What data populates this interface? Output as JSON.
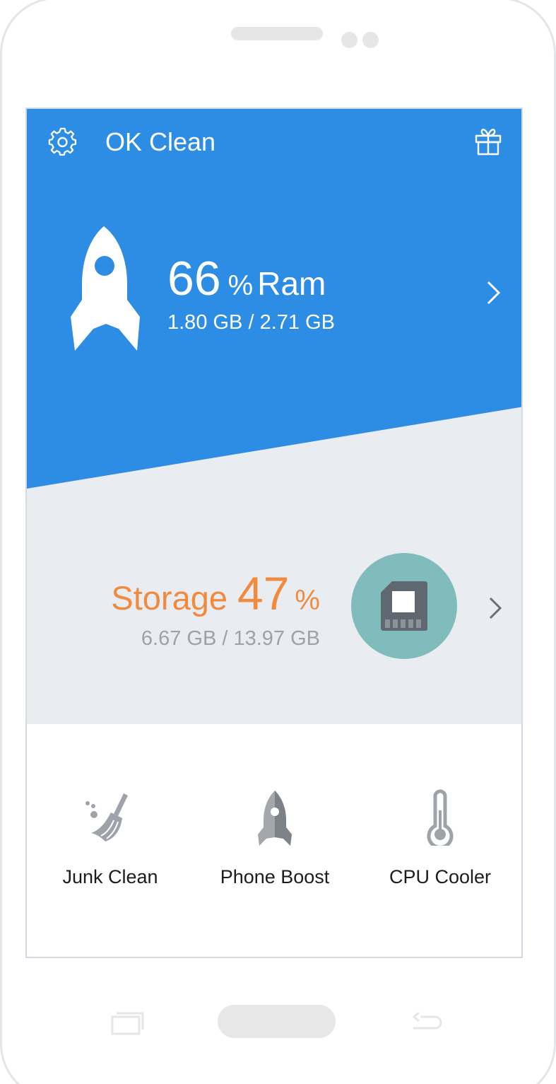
{
  "app": {
    "title": "OK Clean",
    "settings_icon": "gear-icon",
    "gift_icon": "gift-icon",
    "accent_color": "#2d8de5",
    "storage_color": "#f08a3e"
  },
  "ram": {
    "icon": "rocket-icon",
    "value": "66",
    "unit": "%",
    "label": "Ram",
    "detail": "1.80 GB / 2.71 GB"
  },
  "storage": {
    "label": "Storage",
    "value": "47",
    "unit": "%",
    "detail": "6.67 GB / 13.97 GB",
    "icon": "sd-card-icon",
    "icon_circle_color": "#7fbcbb"
  },
  "tools": [
    {
      "label": "Junk Clean",
      "icon": "broom-icon"
    },
    {
      "label": "Phone Boost",
      "icon": "rocket-icon"
    },
    {
      "label": "CPU Cooler",
      "icon": "thermometer-icon"
    }
  ],
  "navbar": {
    "recent_icon": "recent-apps-icon",
    "home_icon": "home-button",
    "back_icon": "back-icon"
  }
}
